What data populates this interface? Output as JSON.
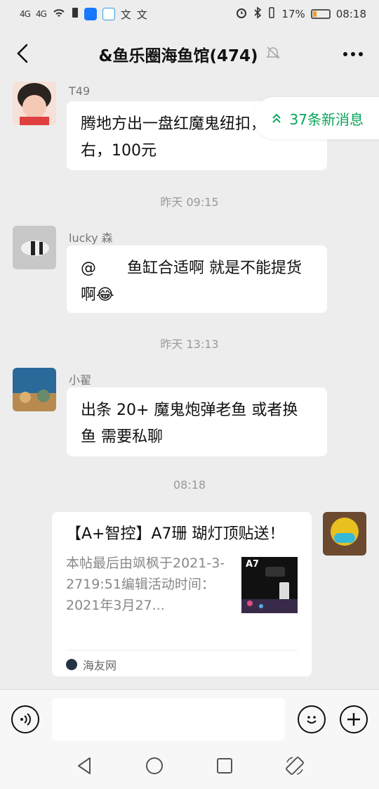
{
  "status_bar": {
    "signal1": "4G",
    "signal2": "4G",
    "battery_percent": "17%",
    "time": "08:18"
  },
  "header": {
    "title": "&鱼乐圈海鱼馆(474)",
    "back_icon": "chevron-left-icon",
    "mute_icon": "bell-off-icon",
    "more_icon": "more-icon"
  },
  "new_messages": {
    "label": "37条新消息",
    "icon": "double-chevron-up-icon"
  },
  "messages": [
    {
      "sender": "T49",
      "text": "腾地方出一盘红魔鬼纽扣，头左右，100元"
    },
    {
      "sender": "lucky 森",
      "text": "@　　鱼缸合适啊  就是不能提货啊😂"
    },
    {
      "sender": "小翟",
      "text": "出条 20+ 魔鬼炮弹老鱼  或者换鱼  需要私聊"
    }
  ],
  "timestamps": [
    "昨天 09:15",
    "昨天 13:13",
    "08:18"
  ],
  "card": {
    "title": "【A+智控】A7珊 瑚灯顶贴送！",
    "desc": "本帖最后由飒枫于2021-3-2719:51编辑活动时间：2021年3月27...",
    "thumb_title": "A7",
    "source": "海友网"
  },
  "input_bar": {
    "voice_icon": "voice-icon",
    "emoji_icon": "emoji-icon",
    "plus_icon": "plus-icon"
  },
  "nav_bar": {
    "back_icon": "triangle-back-icon",
    "home_icon": "circle-home-icon",
    "recent_icon": "square-recent-icon",
    "rotate_icon": "rotate-icon"
  }
}
